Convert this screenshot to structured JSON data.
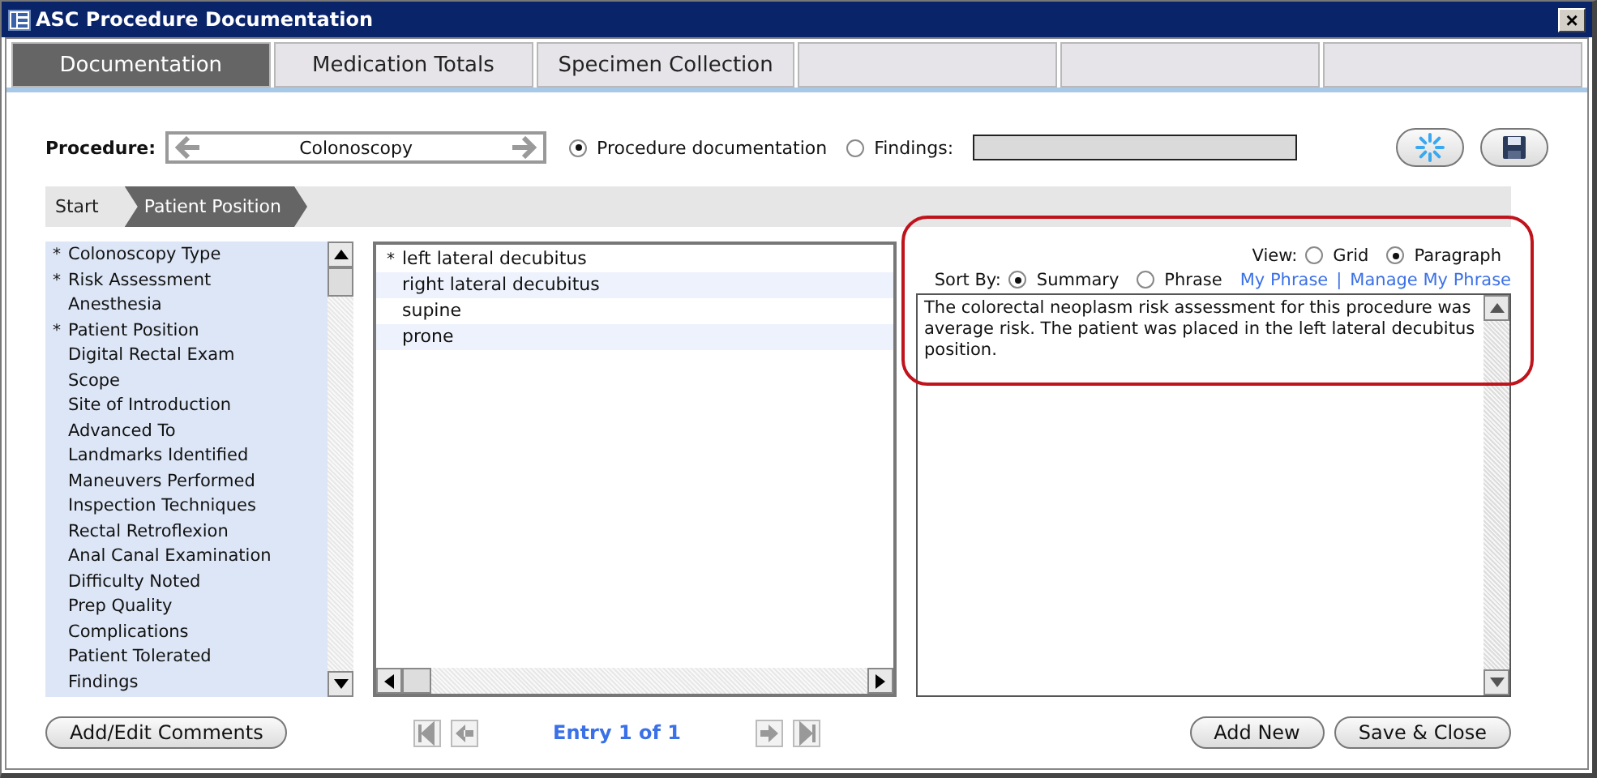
{
  "window": {
    "title": "ASC Procedure Documentation",
    "close": "×"
  },
  "tabs": [
    {
      "label": "Documentation",
      "selected": true
    },
    {
      "label": "Medication Totals",
      "selected": false
    },
    {
      "label": "Specimen Collection",
      "selected": false
    },
    {
      "selected": false
    },
    {
      "selected": false
    },
    {
      "selected": false
    }
  ],
  "procedure": {
    "label": "Procedure:",
    "value": "Colonoscopy"
  },
  "mode": [
    {
      "label": "Procedure documentation",
      "selected": true
    },
    {
      "label": "Findings:",
      "selected": false
    }
  ],
  "breadcrumb": [
    {
      "label": "Start",
      "selected": false
    },
    {
      "label": "Patient Position",
      "selected": true
    }
  ],
  "sections": [
    {
      "marker": "*",
      "label": "Colonoscopy Type"
    },
    {
      "marker": "*",
      "label": "Risk Assessment"
    },
    {
      "label": "Anesthesia"
    },
    {
      "marker": "*",
      "label": "Patient Position"
    },
    {
      "label": "Digital Rectal Exam"
    },
    {
      "label": "Scope"
    },
    {
      "label": "Site of Introduction"
    },
    {
      "label": "Advanced To"
    },
    {
      "label": "Landmarks Identified"
    },
    {
      "label": "Maneuvers Performed"
    },
    {
      "label": "Inspection Techniques"
    },
    {
      "label": "Rectal Retroflexion"
    },
    {
      "label": "Anal Canal Examination"
    },
    {
      "label": "Difficulty Noted"
    },
    {
      "label": "Prep Quality"
    },
    {
      "label": "Complications"
    },
    {
      "label": "Patient Tolerated"
    },
    {
      "label": "Findings"
    }
  ],
  "options": [
    {
      "marker": "*",
      "label": "left lateral decubitus"
    },
    {
      "label": "right lateral decubitus"
    },
    {
      "label": "supine"
    },
    {
      "label": "prone"
    }
  ],
  "view": {
    "label": "View:",
    "options": [
      {
        "label": "Grid",
        "selected": false
      },
      {
        "label": "Paragraph",
        "selected": true
      }
    ]
  },
  "sort": {
    "label": "Sort By:",
    "options": [
      {
        "label": "Summary",
        "selected": true
      },
      {
        "label": "Phrase",
        "selected": false
      }
    ],
    "links": [
      "My Phrase",
      "Manage My Phrase"
    ],
    "separator": "|"
  },
  "paragraph": "The colorectal neoplasm risk assessment for this procedure was average risk. The patient was placed in the left lateral decubitus position.",
  "footer": {
    "comments": "Add/Edit Comments",
    "entry": "Entry 1 of 1",
    "add": "Add New",
    "save": "Save & Close"
  }
}
